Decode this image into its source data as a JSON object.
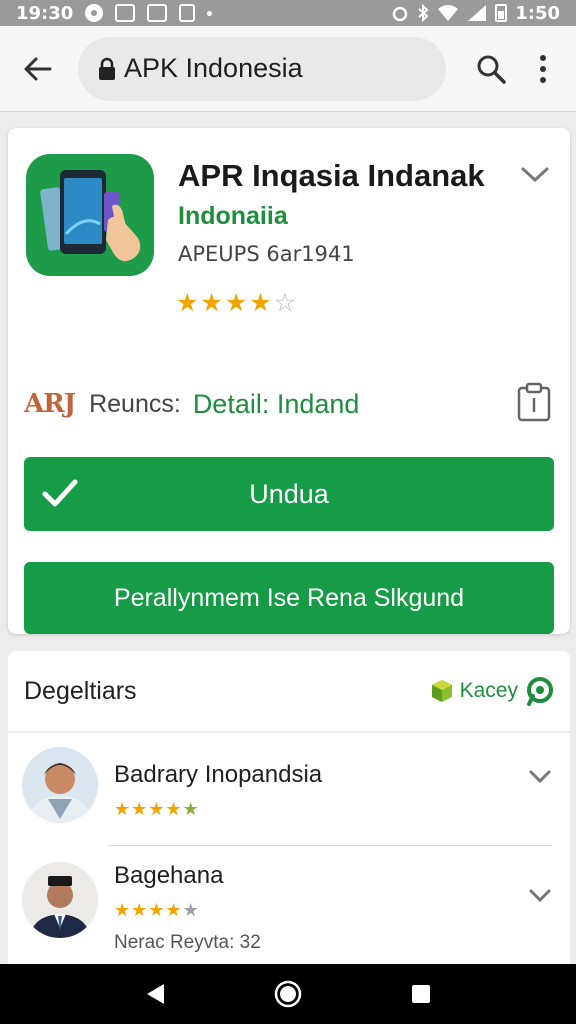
{
  "status_bar": {
    "time_left": "19:30",
    "time_right": "1:50",
    "icons": [
      "circle-icon",
      "image-icon",
      "cast-icon",
      "phone-icon",
      "dot-icon",
      "alarm-icon",
      "bluetooth-icon",
      "wifi-icon",
      "signal-icon",
      "battery-icon"
    ]
  },
  "browser": {
    "url_text": "APK Indonesia",
    "icons": [
      "back-arrow-icon",
      "lock-icon",
      "search-icon",
      "more-vert-icon"
    ]
  },
  "app": {
    "title": "APR Inqasia Indanak",
    "developer": "Indonaiia",
    "meta": "APEUPS 6ar1941",
    "rating": 4,
    "rating_max": 5,
    "icon": "app-phone-icon"
  },
  "details": {
    "logo_text": "ARJ",
    "prefix": "Reuncs:",
    "link_text": "Detail: Indand"
  },
  "buttons": {
    "download_label": "Undua",
    "secondary_label": "Perallynmem Ise Rena Slkgund"
  },
  "reviews": {
    "title": "Degeltiars",
    "action_label": "Kacey",
    "items": [
      {
        "name": "Badrary Inopandsia",
        "rating": 5,
        "meta": ""
      },
      {
        "name": "Bagehana",
        "rating": 4,
        "meta": "Nerac Reyvta: 32"
      }
    ]
  },
  "colors": {
    "accent_green": "#169c46",
    "text_green": "#1e8e3e",
    "star": "#f0a500"
  }
}
